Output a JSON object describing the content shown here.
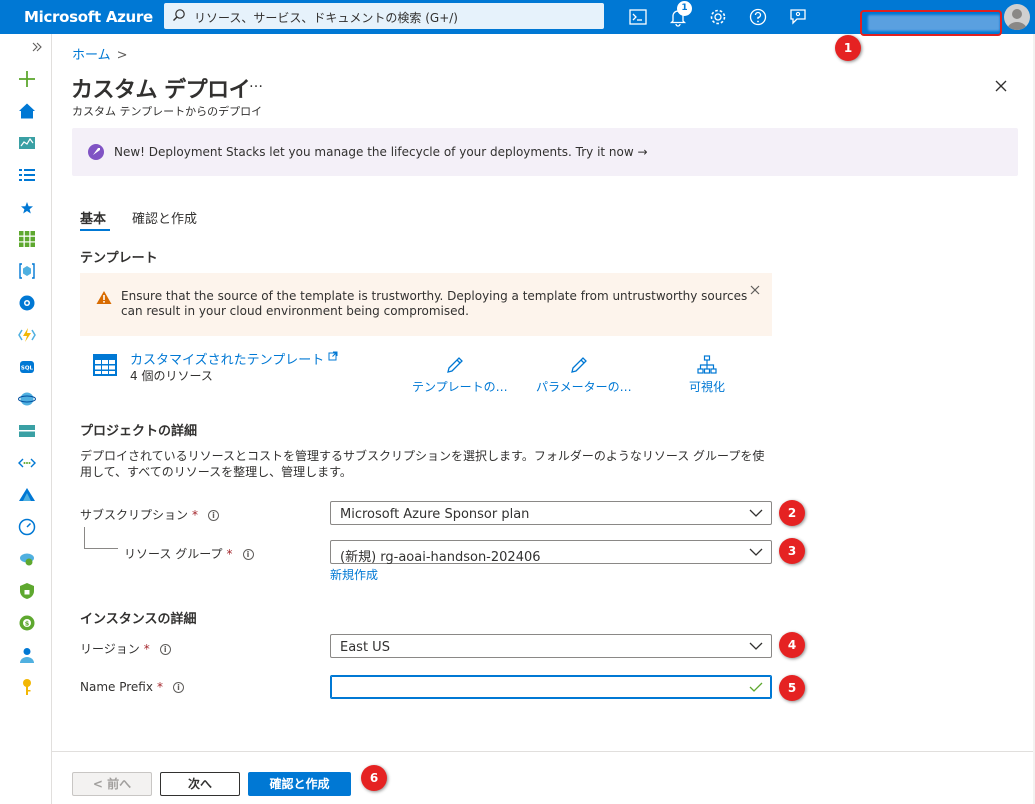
{
  "topbar": {
    "brand": "Microsoft Azure",
    "search_placeholder": "リソース、サービス、ドキュメントの検索 (G+/)",
    "notification_count": "1"
  },
  "breadcrumb": {
    "home": "ホーム",
    "separator": ">"
  },
  "page": {
    "title": "カスタム デプロイ",
    "more": "…",
    "subtitle": "カスタム テンプレートからのデプロイ"
  },
  "banner": {
    "text": "New! Deployment Stacks let you manage the lifecycle of your deployments. Try it now →"
  },
  "tabs": [
    {
      "label": "基本",
      "active": true
    },
    {
      "label": "確認と作成",
      "active": false
    }
  ],
  "template_section": {
    "heading": "テンプレート",
    "warning": "Ensure that the source of the template is trustworthy. Deploying a template from untrustworthy sources can result in your cloud environment being compromised.",
    "template_link": "カスタマイズされたテンプレート",
    "resource_count": "4 個のリソース",
    "actions": [
      "テンプレートの…",
      "パラメーターの…",
      "可視化"
    ]
  },
  "project_section": {
    "heading": "プロジェクトの詳細",
    "description": "デプロイされているリソースとコストを管理するサブスクリプションを選択します。フォルダーのようなリソース グループを使用して、すべてのリソースを整理し、管理します。",
    "subscription_label": "サブスクリプション",
    "subscription_value": "Microsoft Azure Sponsor plan",
    "resource_group_label": "リソース グループ",
    "resource_group_value": "(新規) rg-aoai-handson-202406",
    "create_new": "新規作成"
  },
  "instance_section": {
    "heading": "インスタンスの詳細",
    "region_label": "リージョン",
    "region_value": "East US",
    "name_prefix_label": "Name Prefix",
    "name_prefix_value": ""
  },
  "required_mark": "*",
  "info_mark": "i",
  "footer": {
    "prev": "< 前へ",
    "next": "次へ",
    "review": "確認と作成"
  },
  "markers": [
    "1",
    "2",
    "3",
    "4",
    "5",
    "6"
  ],
  "colors": {
    "accent": "#0078d4",
    "marker": "#e52222",
    "banner_bg": "#f4f0f8",
    "warning_bg": "#fdf4ec"
  }
}
